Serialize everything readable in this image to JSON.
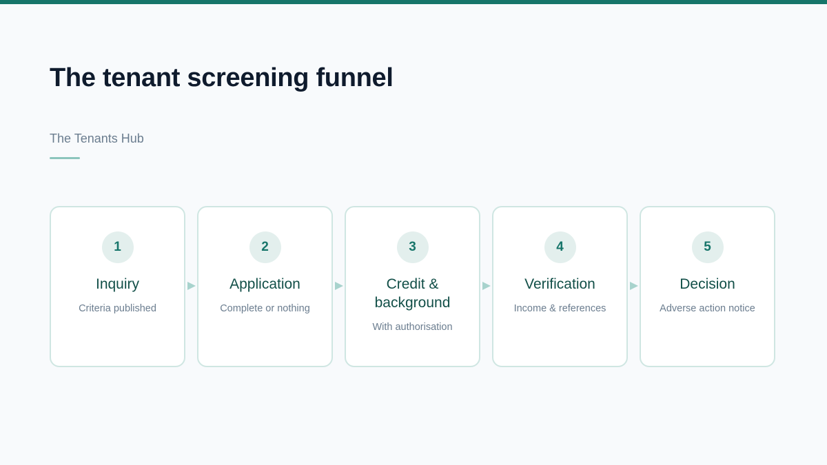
{
  "title": "The tenant screening funnel",
  "subtitle": "The Tenants Hub",
  "colors": {
    "accent": "#17756a",
    "title_text": "#0f1b2d",
    "card_border": "#cfe6e2",
    "badge_bg": "#e3efed",
    "step_title": "#124f48",
    "muted_text": "#6b7d8f"
  },
  "steps": [
    {
      "number": "1",
      "title": "Inquiry",
      "description": "Criteria published"
    },
    {
      "number": "2",
      "title": "Application",
      "description": "Complete or nothing"
    },
    {
      "number": "3",
      "title": "Credit & background",
      "description": "With authorisation"
    },
    {
      "number": "4",
      "title": "Verification",
      "description": "Income & references"
    },
    {
      "number": "5",
      "title": "Decision",
      "description": "Adverse action notice"
    }
  ],
  "connector_icon": "arrow-right-icon"
}
